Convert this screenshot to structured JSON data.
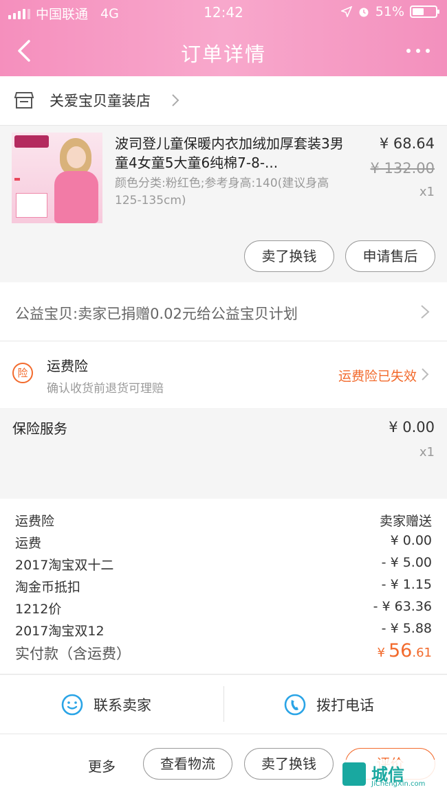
{
  "status_bar": {
    "carrier": "中国联通",
    "network": "4G",
    "time": "12:42",
    "battery": "51%"
  },
  "nav": {
    "title": "订单详情"
  },
  "shop": {
    "name": "关爱宝贝童装店"
  },
  "product": {
    "title": "波司登儿童保暖内衣加绒加厚套装3男童4女童5大童6纯棉7-8-...",
    "spec": "颜色分类:粉红色;参考身高:140(建议身高125-135cm)",
    "price": "¥ 68.64",
    "original_price": "¥ 132.00",
    "qty": "x1",
    "buttons": {
      "sell": "卖了换钱",
      "after_sale": "申请售后"
    }
  },
  "charity": {
    "text": "公益宝贝:卖家已捐赠0.02元给公益宝贝计划"
  },
  "shipping_insurance": {
    "icon_text": "险",
    "title": "运费险",
    "subtitle": "确认收货前退货可理赔",
    "status": "运费险已失效"
  },
  "insurance_service": {
    "title": "保险服务",
    "price": "¥ 0.00",
    "qty": "x1"
  },
  "fees": [
    {
      "label": "运费险",
      "value": "卖家赠送"
    },
    {
      "label": "运费",
      "value": "¥ 0.00"
    },
    {
      "label": "2017淘宝双十二",
      "value": "- ¥ 5.00"
    },
    {
      "label": "淘金币抵扣",
      "value": "- ¥ 1.15"
    },
    {
      "label": "1212价",
      "value": "- ¥ 63.36"
    },
    {
      "label": "2017淘宝双12",
      "value": "- ¥ 5.88"
    }
  ],
  "paid": {
    "label": "实付款（含运费）",
    "currency": "¥",
    "integer": "56",
    "decimal": ".61"
  },
  "contact": {
    "seller": "联系卖家",
    "phone": "拨打电话"
  },
  "actions": {
    "more": "更多",
    "logistics": "查看物流",
    "sell": "卖了换钱",
    "review": "评价"
  },
  "watermark": {
    "cn": "城信",
    "en": "JiChengXin.com"
  },
  "colors": {
    "header_pink": "#f8a8cc",
    "accent_orange": "#f26a2c",
    "contact_blue": "#2aa4e6"
  }
}
